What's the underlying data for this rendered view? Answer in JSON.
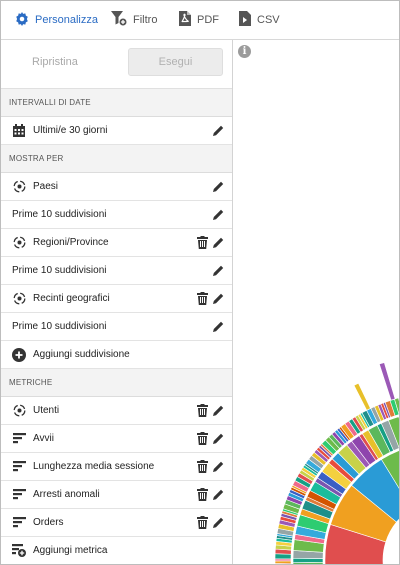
{
  "toolbar": {
    "personalizza": "Personalizza",
    "filtro": "Filtro",
    "pdf": "PDF",
    "csv": "CSV"
  },
  "actions": {
    "ripristina": "Ripristina",
    "esegui": "Esegui"
  },
  "sections": {
    "date": "INTERVALLI DI DATE",
    "mostra": "MOSTRA PER",
    "metriche": "METRICHE"
  },
  "date_range": "Ultimi/e 30 giorni",
  "mostra_per": [
    {
      "label": "Paesi"
    },
    {
      "label": "Prime 10 suddivisioni"
    },
    {
      "label": "Regioni/Province"
    },
    {
      "label": "Prime 10 suddivisioni"
    },
    {
      "label": "Recinti geografici"
    },
    {
      "label": "Prime 10 suddivisioni"
    },
    {
      "label": "Aggiungi suddivisione"
    }
  ],
  "metriche": [
    {
      "label": "Utenti"
    },
    {
      "label": "Avvii"
    },
    {
      "label": "Lunghezza media sessione"
    },
    {
      "label": "Arresti anomali"
    },
    {
      "label": "Orders"
    },
    {
      "label": "Aggiungi metrica"
    }
  ],
  "info_icon": "i",
  "colors": {
    "accent": "#2b6cc4",
    "palette": [
      "#e04e4e",
      "#f0a020",
      "#2a9bd6",
      "#6dbb4b",
      "#7a55b0",
      "#e8c02a",
      "#1f8f8a",
      "#c7d24a",
      "#ef6a8a",
      "#3a5fc4",
      "#5cb85c",
      "#e07b39",
      "#9b59b6",
      "#34aadc",
      "#f4d03f",
      "#16a085",
      "#d35400",
      "#8e44ad",
      "#2ecc71",
      "#e74c3c",
      "#95a5a6",
      "#1abc9c"
    ]
  }
}
